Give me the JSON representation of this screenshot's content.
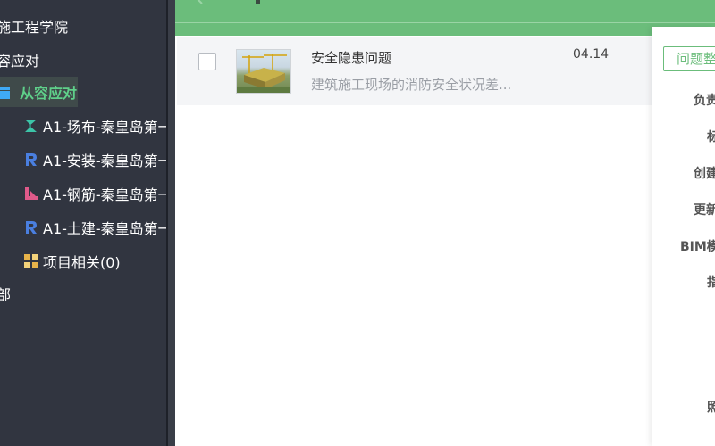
{
  "sidebar": {
    "items": [
      {
        "label": "施工程学院",
        "icon": "none"
      },
      {
        "label": "容应对",
        "icon": "none"
      },
      {
        "label": "从容应对",
        "icon": "building-icon"
      },
      {
        "label": "A1-场布-秦皇岛第一",
        "icon": "site-layout-icon"
      },
      {
        "label": "A1-安装-秦皇岛第一",
        "icon": "revit-icon"
      },
      {
        "label": "A1-钢筋-秦皇岛第一",
        "icon": "rebar-icon"
      },
      {
        "label": "A1-土建-秦皇岛第一",
        "icon": "revit-icon"
      },
      {
        "label": "项目相关(0)",
        "icon": "folder-grid-icon"
      },
      {
        "label": "部",
        "icon": "none"
      }
    ]
  },
  "list": {
    "rows": [
      {
        "title": "安全隐患问题",
        "description": "建筑施工现场的消防安全状况差...",
        "date": "04.14"
      }
    ]
  },
  "detail_panel": {
    "input_value": "问题整",
    "labels": [
      "负责",
      "标",
      "创建",
      "更新",
      "BIM模",
      "指",
      "照"
    ]
  },
  "colors": {
    "accent": "#6bbd7b",
    "active_text": "#5fd08a",
    "sidebar_bg": "#313540"
  }
}
